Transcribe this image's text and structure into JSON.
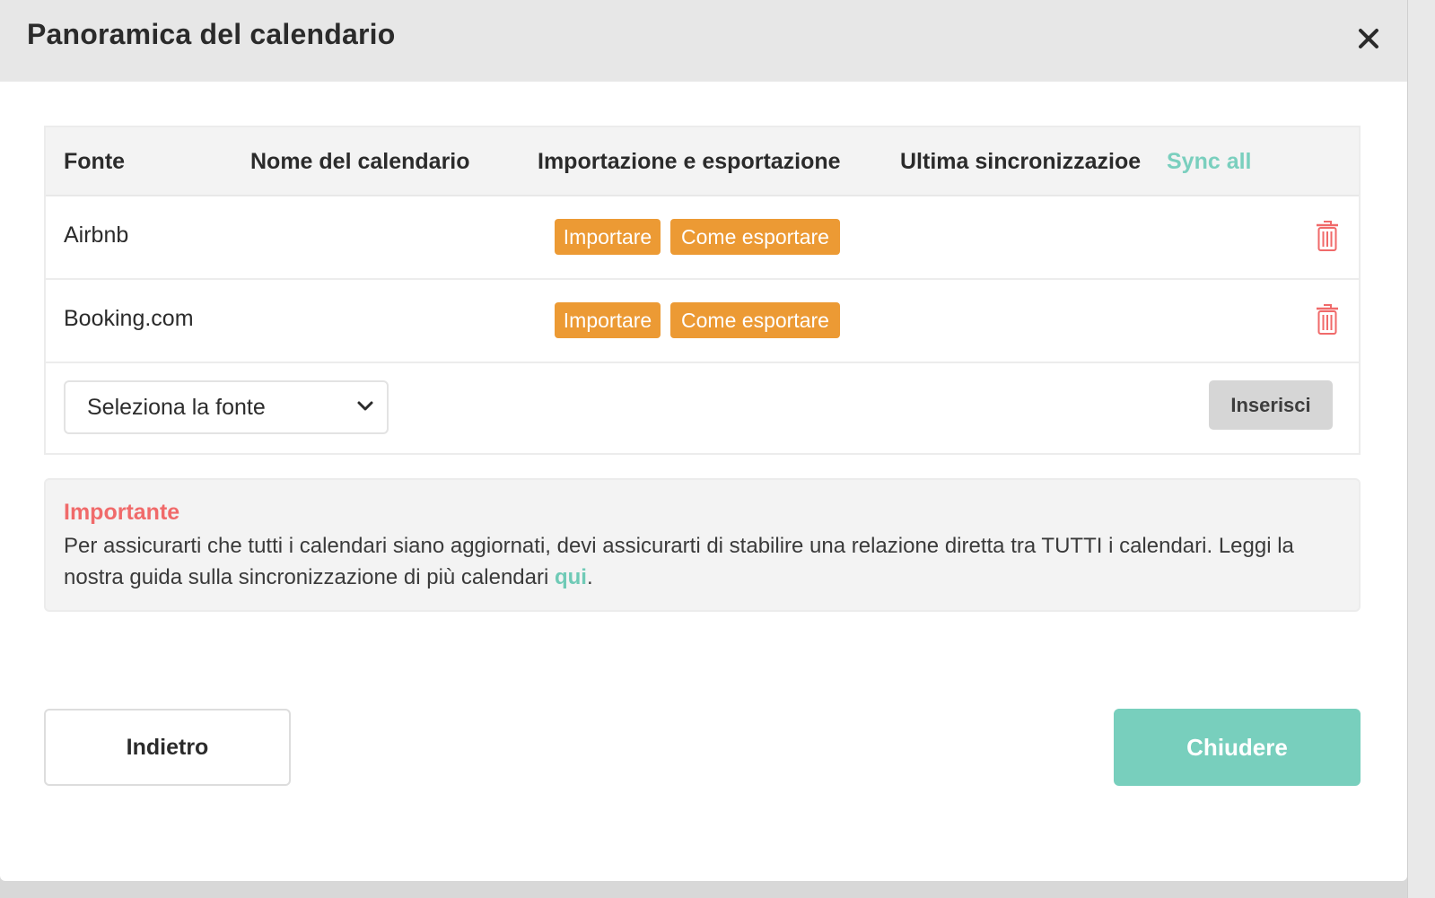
{
  "modal": {
    "title": "Panoramica del calendario",
    "close_icon": "close-icon"
  },
  "table": {
    "headers": {
      "source": "Fonte",
      "calendar_name": "Nome del calendario",
      "import_export": "Importazione e esportazione",
      "last_sync": "Ultima sincronizzazioe",
      "sync_all": "Sync all"
    },
    "rows": [
      {
        "source": "Airbnb",
        "import_label": "Importare",
        "export_label": "Come esportare",
        "delete_icon": "trash-icon"
      },
      {
        "source": "Booking.com",
        "import_label": "Importare",
        "export_label": "Come esportare",
        "delete_icon": "trash-icon"
      }
    ],
    "add_row": {
      "select_value": "Seleziona la fonte",
      "select_icon": "chevron-down-icon",
      "insert_label": "Inserisci"
    }
  },
  "notice": {
    "title": "Importante",
    "body": "Per assicurarti che tutti i calendari siano aggiornati, devi assicurarti di stabilire una relazione diretta tra TUTTI i calendari. Leggi la nostra guida sulla sincronizzazione di più calendari ",
    "link": "qui",
    "end": "."
  },
  "footer": {
    "back_label": "Indietro",
    "close_label": "Chiudere"
  },
  "colors": {
    "accent_teal": "#78cfbd",
    "button_orange": "#ec9a34",
    "danger_red": "#f06a6a",
    "header_gray": "#e7e7e7"
  }
}
